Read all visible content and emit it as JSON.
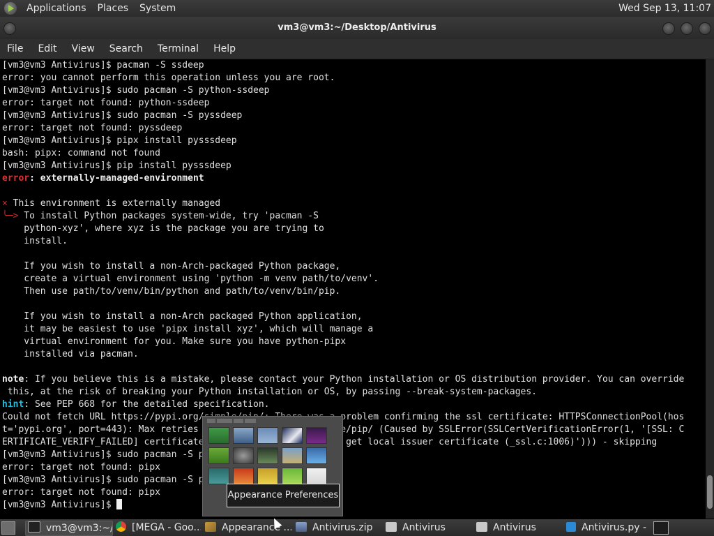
{
  "top_panel": {
    "menus": [
      "Applications",
      "Places",
      "System"
    ],
    "clock": "Wed Sep 13, 11:07"
  },
  "window": {
    "title": "vm3@vm3:~/Desktop/Antivirus",
    "menus": [
      "File",
      "Edit",
      "View",
      "Search",
      "Terminal",
      "Help"
    ]
  },
  "terminal": {
    "lines": [
      {
        "text": "[vm3@vm3 Antivirus]$ pacman -S ssdeep"
      },
      {
        "text": "error: you cannot perform this operation unless you are root."
      },
      {
        "text": "[vm3@vm3 Antivirus]$ sudo pacman -S python-ssdeep"
      },
      {
        "text": "error: target not found: python-ssdeep"
      },
      {
        "text": "[vm3@vm3 Antivirus]$ sudo pacman -S pyssdeep"
      },
      {
        "text": "error: target not found: pyssdeep"
      },
      {
        "text": "[vm3@vm3 Antivirus]$ pipx install pysssdeep"
      },
      {
        "text": "bash: pipx: command not found"
      },
      {
        "text": "[vm3@vm3 Antivirus]$ pip install pysssdeep"
      },
      {
        "prefix": "error",
        "prefix_style": "red",
        "text": ": externally-managed-environment",
        "style": "bold"
      },
      {
        "text": ""
      },
      {
        "prefix": "×",
        "prefix_style": "ring",
        "text": " This environment is externally managed"
      },
      {
        "prefix": "╰─>",
        "prefix_style": "ring",
        "text": " To install Python packages system-wide, try 'pacman -S"
      },
      {
        "text": "    python-xyz', where xyz is the package you are trying to"
      },
      {
        "text": "    install."
      },
      {
        "text": ""
      },
      {
        "text": "    If you wish to install a non-Arch-packaged Python package,"
      },
      {
        "text": "    create a virtual environment using 'python -m venv path/to/venv'."
      },
      {
        "text": "    Then use path/to/venv/bin/python and path/to/venv/bin/pip."
      },
      {
        "text": ""
      },
      {
        "text": "    If you wish to install a non-Arch packaged Python application,"
      },
      {
        "text": "    it may be easiest to use 'pipx install xyz', which will manage a"
      },
      {
        "text": "    virtual environment for you. Make sure you have python-pipx"
      },
      {
        "text": "    installed via pacman."
      },
      {
        "text": ""
      },
      {
        "prefix": "note",
        "prefix_style": "bold",
        "text": ": If you believe this is a mistake, please contact your Python installation or OS distribution provider. You can override"
      },
      {
        "text": " this, at the risk of breaking your Python installation or OS, by passing --break-system-packages."
      },
      {
        "prefix": "hint",
        "prefix_style": "hint",
        "text": ": See PEP 668 for the detailed specification."
      },
      {
        "text": "Could not fetch URL https://pypi.org/simple/pip/: There was a problem confirming the ssl certificate: HTTPSConnectionPool(hos"
      },
      {
        "text": "t='pypi.org', port=443): Max retries exceeded with url: /simple/pip/ (Caused by SSLError(SSLCertVerificationError(1, '[SSL: C"
      },
      {
        "text": "ERTIFICATE_VERIFY_FAILED] certificate verify failed: unable to get local issuer certificate (_ssl.c:1006)'))) - skipping"
      },
      {
        "text": "[vm3@vm3 Antivirus]$ sudo pacman -S pipx"
      },
      {
        "text": "error: target not found: pipx"
      },
      {
        "text": "[vm3@vm3 Antivirus]$ sudo pacman -S pipx"
      },
      {
        "text": "error: target not found: pipx"
      },
      {
        "text": "[vm3@vm3 Antivirus]$ ",
        "cursor": true
      }
    ]
  },
  "tooltip": "Appearance Preferences",
  "taskbar": {
    "tasks": [
      {
        "label": "vm3@vm3:~/...",
        "icon": "terminal-icon",
        "active": true
      },
      {
        "label": "[MEGA - Goo...",
        "icon": "chrome-icon",
        "active": false
      },
      {
        "label": "Appearance ...",
        "icon": "appearance-icon",
        "active": false
      },
      {
        "label": "Antivirus.zip",
        "icon": "archive-icon",
        "active": false
      },
      {
        "label": "Antivirus",
        "icon": "folder-icon",
        "active": false
      },
      {
        "label": "Antivirus",
        "icon": "folder-icon",
        "active": false
      },
      {
        "label": "Antivirus.py - ...",
        "icon": "vscode-icon",
        "active": false
      }
    ]
  },
  "colors": {
    "terminal_bg": "#000000",
    "terminal_fg": "#e0e0e0",
    "error_red": "#e03030",
    "hint_cyan": "#29b8d8"
  }
}
